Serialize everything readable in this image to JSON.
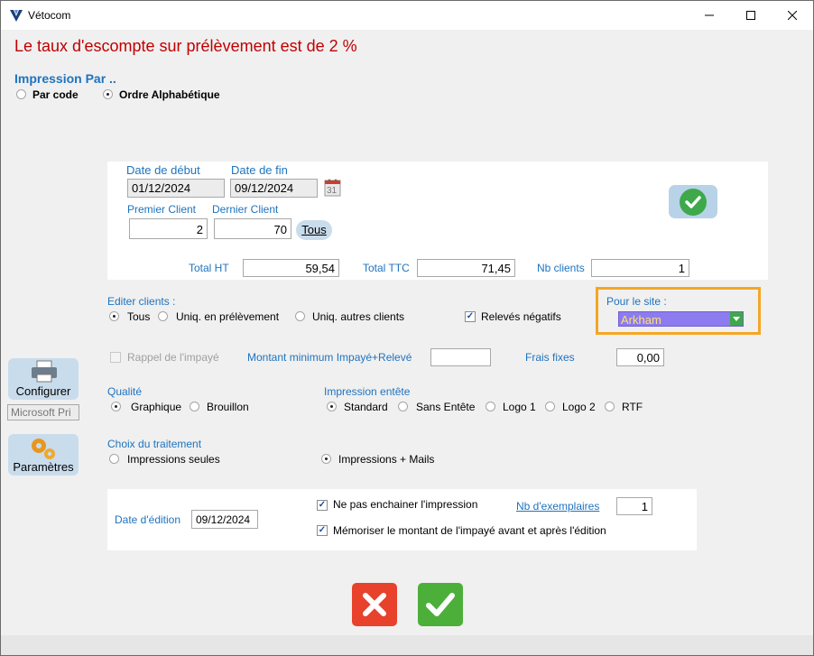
{
  "window": {
    "title": "Vétocom"
  },
  "heading": "Le taux d'escompte sur prélèvement est de 2 %",
  "impression_par": {
    "label": "Impression Par ..",
    "options": [
      "Par code",
      "Ordre Alphabétique"
    ],
    "selected": "Ordre Alphabétique"
  },
  "range": {
    "date_debut_label": "Date de début",
    "date_debut": "01/12/2024",
    "date_fin_label": "Date de fin",
    "date_fin": "09/12/2024",
    "calendar_number": "31",
    "premier_client_label": "Premier Client",
    "premier_client": "2",
    "dernier_client_label": "Dernier Client",
    "dernier_client": "70",
    "tous_button": "Tous"
  },
  "totals": {
    "total_ht_label": "Total HT",
    "total_ht": "59,54",
    "total_ttc_label": "Total TTC",
    "total_ttc": "71,45",
    "nb_clients_label": "Nb clients",
    "nb_clients": "1"
  },
  "editer_clients": {
    "label": "Editer clients :",
    "options": [
      "Tous",
      "Uniq. en prélèvement",
      "Uniq. autres clients"
    ],
    "selected": "Tous",
    "releves_negatifs": "Relevés négatifs"
  },
  "site": {
    "label": "Pour le site :",
    "value": "Arkham",
    "highlight_color": "#f5a623",
    "select_color": "#8c7cf0",
    "text_color": "#ffe070"
  },
  "impaye": {
    "rappel_label": "Rappel de l'impayé",
    "montant_min_label": "Montant minimum Impayé+Relevé",
    "montant_min": "",
    "frais_fixes_label": "Frais fixes",
    "frais_fixes": "0,00"
  },
  "sidebar": {
    "configurer_label": "Configurer",
    "printer_name": "Microsoft Pri",
    "parametres_label": "Paramètres"
  },
  "qualite": {
    "label": "Qualité",
    "options": [
      "Graphique",
      "Brouillon"
    ],
    "selected": "Graphique"
  },
  "entete": {
    "label": "Impression entête",
    "options": [
      "Standard",
      "Sans Entête",
      "Logo 1",
      "Logo 2",
      "RTF"
    ],
    "selected": "Standard"
  },
  "traitement": {
    "label": "Choix du traitement",
    "options": [
      "Impressions seules",
      "Impressions + Mails"
    ],
    "selected": "Impressions + Mails"
  },
  "edition": {
    "date_label": "Date d'édition",
    "date": "09/12/2024",
    "ne_pas_enchainer": "Ne pas enchainer l'impression",
    "nb_exemplaires_label": "Nb d'exemplaires",
    "nb_exemplaires": "1",
    "memoriser": "Mémoriser le montant de l'impayé avant et après l'édition"
  },
  "colors": {
    "cancel": "#e8412c",
    "ok": "#4caf3a",
    "heading": "#c00000",
    "label_blue": "#1e73be"
  }
}
